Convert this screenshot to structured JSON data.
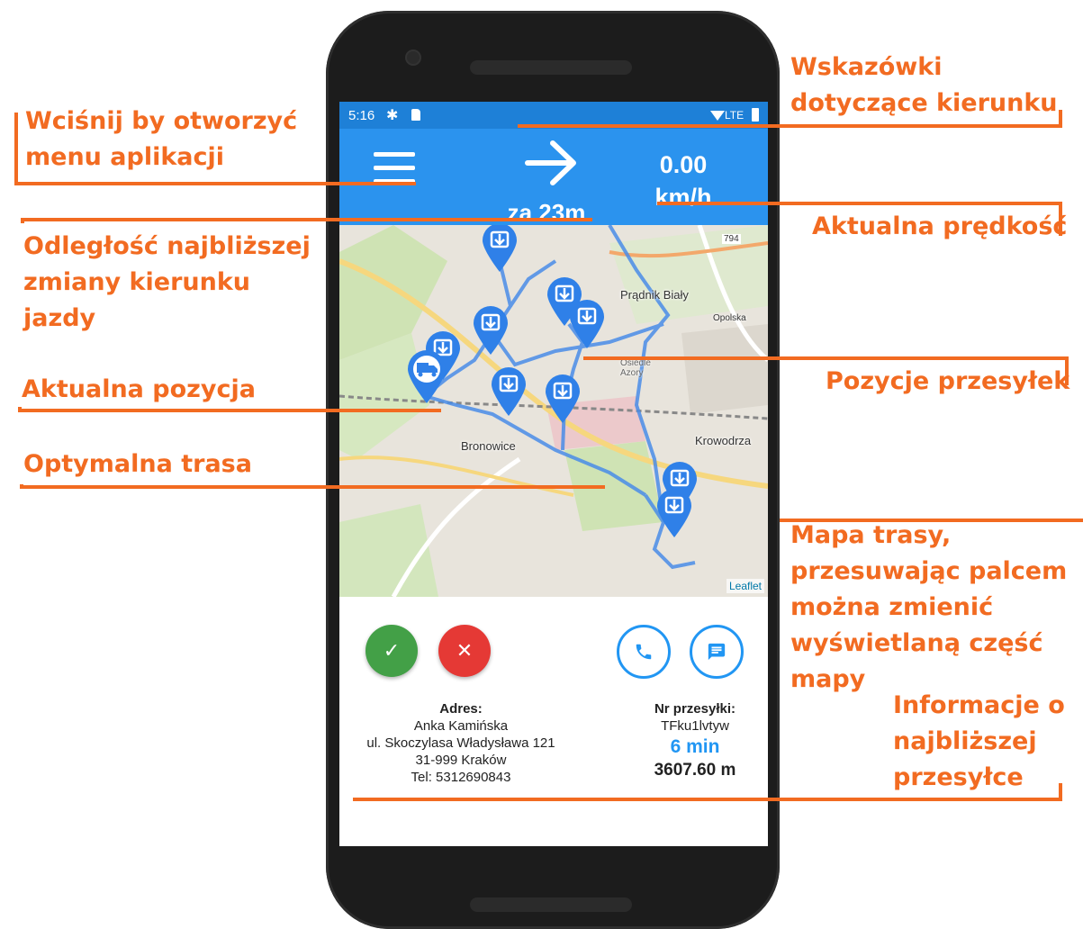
{
  "status_bar": {
    "time": "5:16",
    "network": "LTE"
  },
  "app_bar": {
    "direction_icon": "arrow-right-icon",
    "distance_text": "za 23m",
    "speed_value": "0.00",
    "speed_unit": "km/h"
  },
  "map": {
    "labels": [
      "Prądnik Biały",
      "Bronowice",
      "Krowodrza",
      "Osiedle Azory",
      "Opolska",
      "794"
    ],
    "attribution": "Leaflet",
    "route_color": "#4a8de8",
    "marker_color": "#2f80e8",
    "parcel_marker_count": 10
  },
  "delivery_card": {
    "address_heading": "Adres:",
    "name": "Anka Kamińska",
    "street": "ul. Skoczylasa Władysława 121",
    "city": "31-999 Kraków",
    "phone": "Tel: 5312690843",
    "parcel_heading": "Nr przesyłki:",
    "parcel_id": "TFku1lvtyw",
    "eta": "6 min",
    "distance": "3607.60 m"
  },
  "annotations": {
    "menu": [
      "Wciśnij by otworzyć",
      "menu aplikacji"
    ],
    "distance": [
      "Odległość najbliższej",
      "zmiany kierunku",
      "jazdy"
    ],
    "position": "Aktualna pozycja",
    "route": "Optymalna trasa",
    "directions": [
      "Wskazówki",
      "dotyczące kierunku"
    ],
    "speed": "Aktualna prędkość",
    "parcels": "Pozycje przesyłek",
    "map": [
      "Mapa trasy,",
      "przesuwając palcem",
      "można zmienić",
      "wyświetlaną część",
      "mapy"
    ],
    "info": [
      "Informacje o",
      "najbliższej",
      "przesyłce"
    ]
  },
  "colors": {
    "accent": "#f26b21",
    "app_bar": "#2b93ee",
    "status_bar": "#1e80d7",
    "accept": "#43a047",
    "reject": "#e53935",
    "contact": "#2196f3"
  }
}
